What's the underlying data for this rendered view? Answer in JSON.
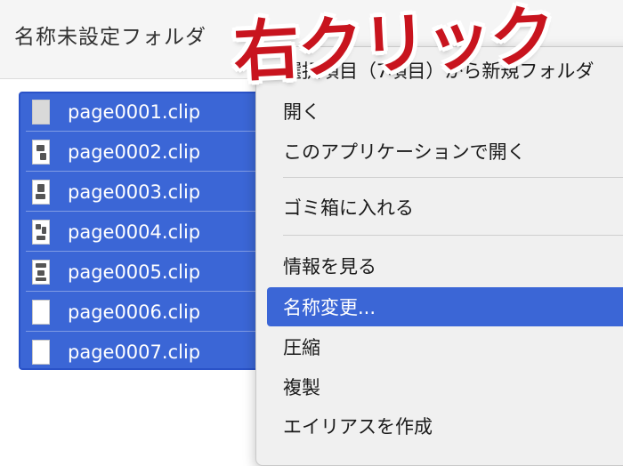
{
  "window": {
    "folder_title": "名称未設定フォルダ"
  },
  "files": [
    {
      "name": "page0001.clip",
      "thumb": "blank-gray"
    },
    {
      "name": "page0002.clip",
      "thumb": "manga"
    },
    {
      "name": "page0003.clip",
      "thumb": "manga"
    },
    {
      "name": "page0004.clip",
      "thumb": "manga"
    },
    {
      "name": "page0005.clip",
      "thumb": "manga"
    },
    {
      "name": "page0006.clip",
      "thumb": "blank-white"
    },
    {
      "name": "page0007.clip",
      "thumb": "blank-white"
    }
  ],
  "context_menu": {
    "items": [
      {
        "label": "選択項目（7項目）から新規フォルダ"
      },
      {
        "label": "開く"
      },
      {
        "label": "このアプリケーションで開く"
      },
      {
        "label": "ゴミ箱に入れる"
      },
      {
        "label": "情報を見る"
      },
      {
        "label": "名称変更..."
      },
      {
        "label": "圧縮"
      },
      {
        "label": "複製"
      },
      {
        "label": "エイリアスを作成"
      }
    ],
    "active_index": 5
  },
  "annotation": {
    "text": "右クリック",
    "color": "#c8141e"
  },
  "colors": {
    "selection": "#3b66d6",
    "menu_bg": "#f0f0f0"
  }
}
